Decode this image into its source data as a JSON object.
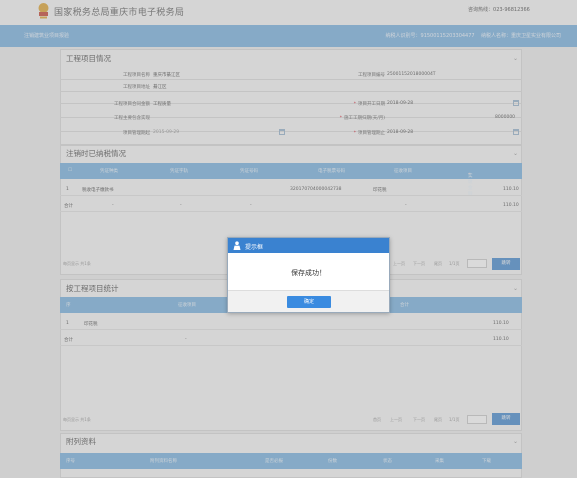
{
  "header": {
    "site_title": "国家税务总局重庆市电子税务局",
    "hotline_label": "咨询热线：",
    "hotline_number": "023-96812366"
  },
  "subheader": {
    "breadcrumb": "注销建筑业项目报验",
    "taxpayer_id_label": "纳税人识别号：",
    "taxpayer_id": "91500115203304477",
    "taxpayer_name_label": "纳税人名称：",
    "taxpayer_name": "重庆卫星实业有限公司"
  },
  "project_info": {
    "title": "工程项目情况",
    "fields": [
      {
        "label": "工程项目名称",
        "value": "重庆市綦江区"
      },
      {
        "label": "工程项目编号",
        "value": "2500115201800004T"
      },
      {
        "label": "工程项目地址",
        "value": "綦江区"
      },
      {
        "label": "项目开工日期",
        "value": "2018-09-28",
        "required": true
      },
      {
        "label": "工程项目合同金额",
        "value": "工程质量"
      },
      {
        "label": "施工工期归期(天/月)",
        "value": "8000000",
        "required": true
      },
      {
        "label": "工程主要包含实现",
        "value": ""
      },
      {
        "label": "项目管理期止",
        "value": "2018-09-28",
        "required": true
      },
      {
        "label": "项目管理期起",
        "value": "2015-09-29"
      }
    ]
  },
  "tax_table": {
    "title": "注销时已纳税情况",
    "columns": [
      "凭证种类",
      "凭证字轨",
      "凭证号码",
      "电子税票号码",
      "征收项目",
      "实缴金额"
    ],
    "rows": [
      {
        "index": "1",
        "cells": [
          "税收电子缴款书",
          "",
          "",
          "320170704000042738",
          "印花税",
          "110.10"
        ]
      },
      {
        "index": "合计",
        "cells": [
          "-",
          "-",
          "-",
          "",
          "-",
          "110.10"
        ]
      }
    ],
    "pager": {
      "summary": "每页显示 共1条",
      "first": "首页",
      "prev": "上一页",
      "next": "下一页",
      "last": "尾页",
      "pages": "1/1页",
      "go": "跳转"
    }
  },
  "stats_table": {
    "title": "按工程项目统计",
    "columns": [
      "征收项目",
      "合计"
    ],
    "rows": [
      {
        "index": "1",
        "cells": [
          "印花税",
          "110.10"
        ]
      },
      {
        "index": "合计",
        "cells": [
          "-",
          "110.10"
        ]
      }
    ],
    "pager": {
      "summary": "每页显示 共1条",
      "first": "首页",
      "prev": "上一页",
      "next": "下一页",
      "last": "尾页",
      "pages": "1/1页",
      "go": "跳转"
    }
  },
  "attachments": {
    "title": "附列资料",
    "columns": [
      "序号",
      "附列资料名称",
      "是否必报",
      "份数",
      "状态",
      "采集",
      "下载"
    ]
  },
  "dialog": {
    "title": "提示框",
    "message": "保存成功！",
    "ok_label": "确定"
  },
  "colors": {
    "accent_blue": "#3a82d0",
    "header_blue": "#7fb6e2",
    "required_red": "#d22233"
  }
}
